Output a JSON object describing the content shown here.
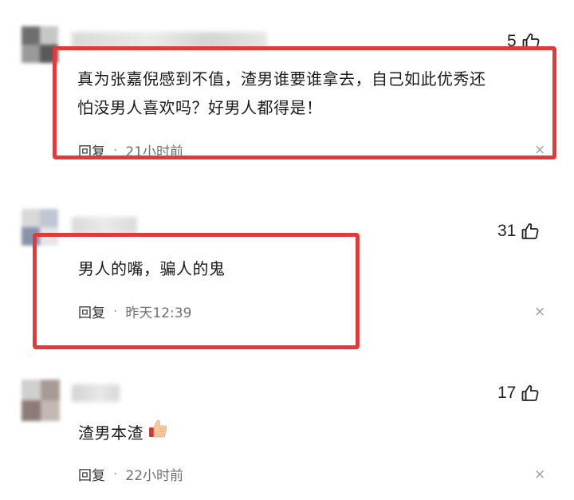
{
  "colors": {
    "highlight": "#e23a3a",
    "text": "#1b1b1b",
    "meta": "#6f6f6f"
  },
  "comments": [
    {
      "likes": "5",
      "text_line1": "真为张嘉倪感到不值，渣男谁要谁拿去，自己如此优秀还",
      "text_line2": "怕没男人喜欢吗？好男人都得是！",
      "reply_label": "回复",
      "separator": "·",
      "time": "21小时前",
      "close_symbol": "×",
      "highlighted": true
    },
    {
      "likes": "31",
      "text_line1": "男人的嘴，骗人的鬼",
      "reply_label": "回复",
      "separator": "·",
      "time": "昨天12:39",
      "close_symbol": "×",
      "highlighted": true
    },
    {
      "likes": "17",
      "text_line1": "渣男本渣",
      "emoji_icon": "thumbs-up-emoji",
      "reply_label": "回复",
      "separator": "·",
      "time": "22小时前",
      "close_symbol": "×",
      "highlighted": false
    }
  ],
  "icons": {
    "like": "thumbs-up-outline-icon",
    "close": "close-icon"
  }
}
